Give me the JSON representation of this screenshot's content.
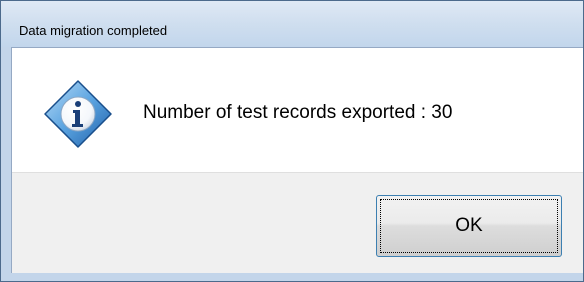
{
  "window": {
    "title": "Data migration completed"
  },
  "dialog": {
    "icon": "information-icon",
    "message": "Number of test records exported : 30",
    "ok_label": "OK"
  },
  "colors": {
    "titlebar": "#c8dbee",
    "content_background": "#ffffff",
    "button_area_background": "#f0f0f0",
    "button_border_focus": "#3c7fb1",
    "icon_blue": "#2e6db4"
  }
}
